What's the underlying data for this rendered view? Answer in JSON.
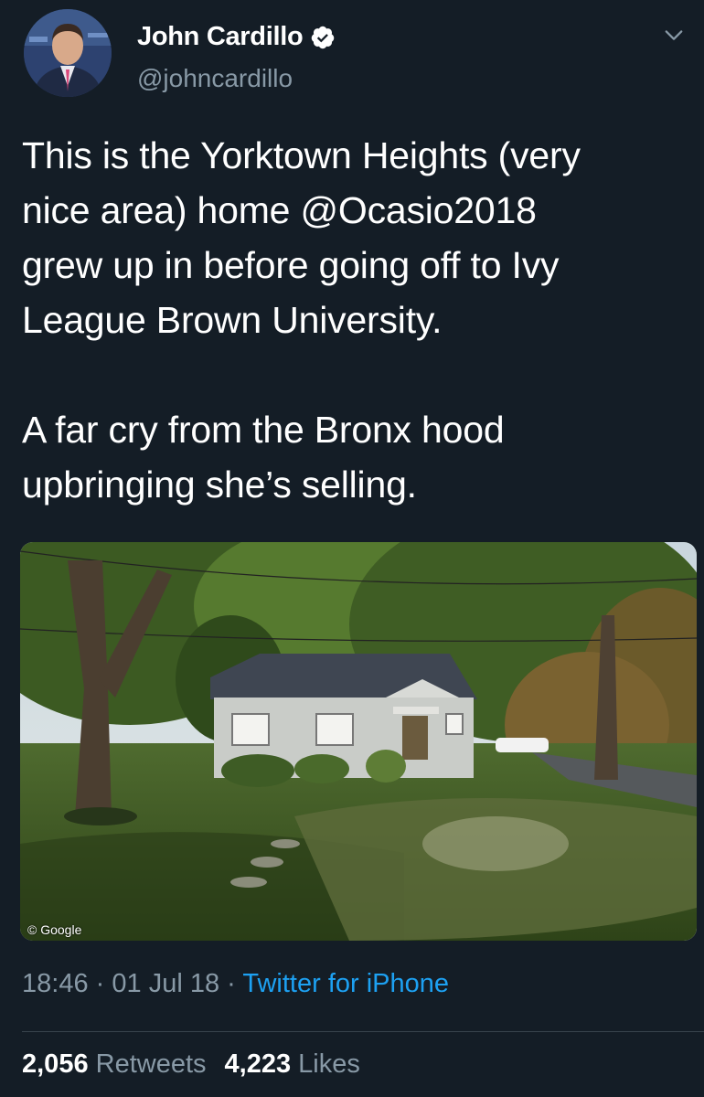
{
  "author": {
    "display_name": "John Cardillo",
    "handle": "@johncardillo",
    "verified": true
  },
  "tweet": {
    "text": "This is the Yorktown Heights (very\nnice area) home @Ocasio2018\ngrew up in before going off to Ivy\nLeague Brown University.\n\nA far cry from the Bronx hood\nupbringing she’s selling."
  },
  "media": {
    "watermark": "© Google"
  },
  "meta": {
    "time": "18:46",
    "separator": "·",
    "date": "01 Jul 18",
    "source": "Twitter for iPhone"
  },
  "stats": {
    "retweets_count": "2,056",
    "retweets_label": "Retweets",
    "likes_count": "4,223",
    "likes_label": "Likes"
  },
  "colors": {
    "background": "#141d26",
    "secondary_text": "#8899a6",
    "link": "#1da1f2",
    "verified": "#ffffff"
  },
  "icons": {
    "verified": "verified-badge-icon",
    "more": "chevron-down-icon"
  }
}
